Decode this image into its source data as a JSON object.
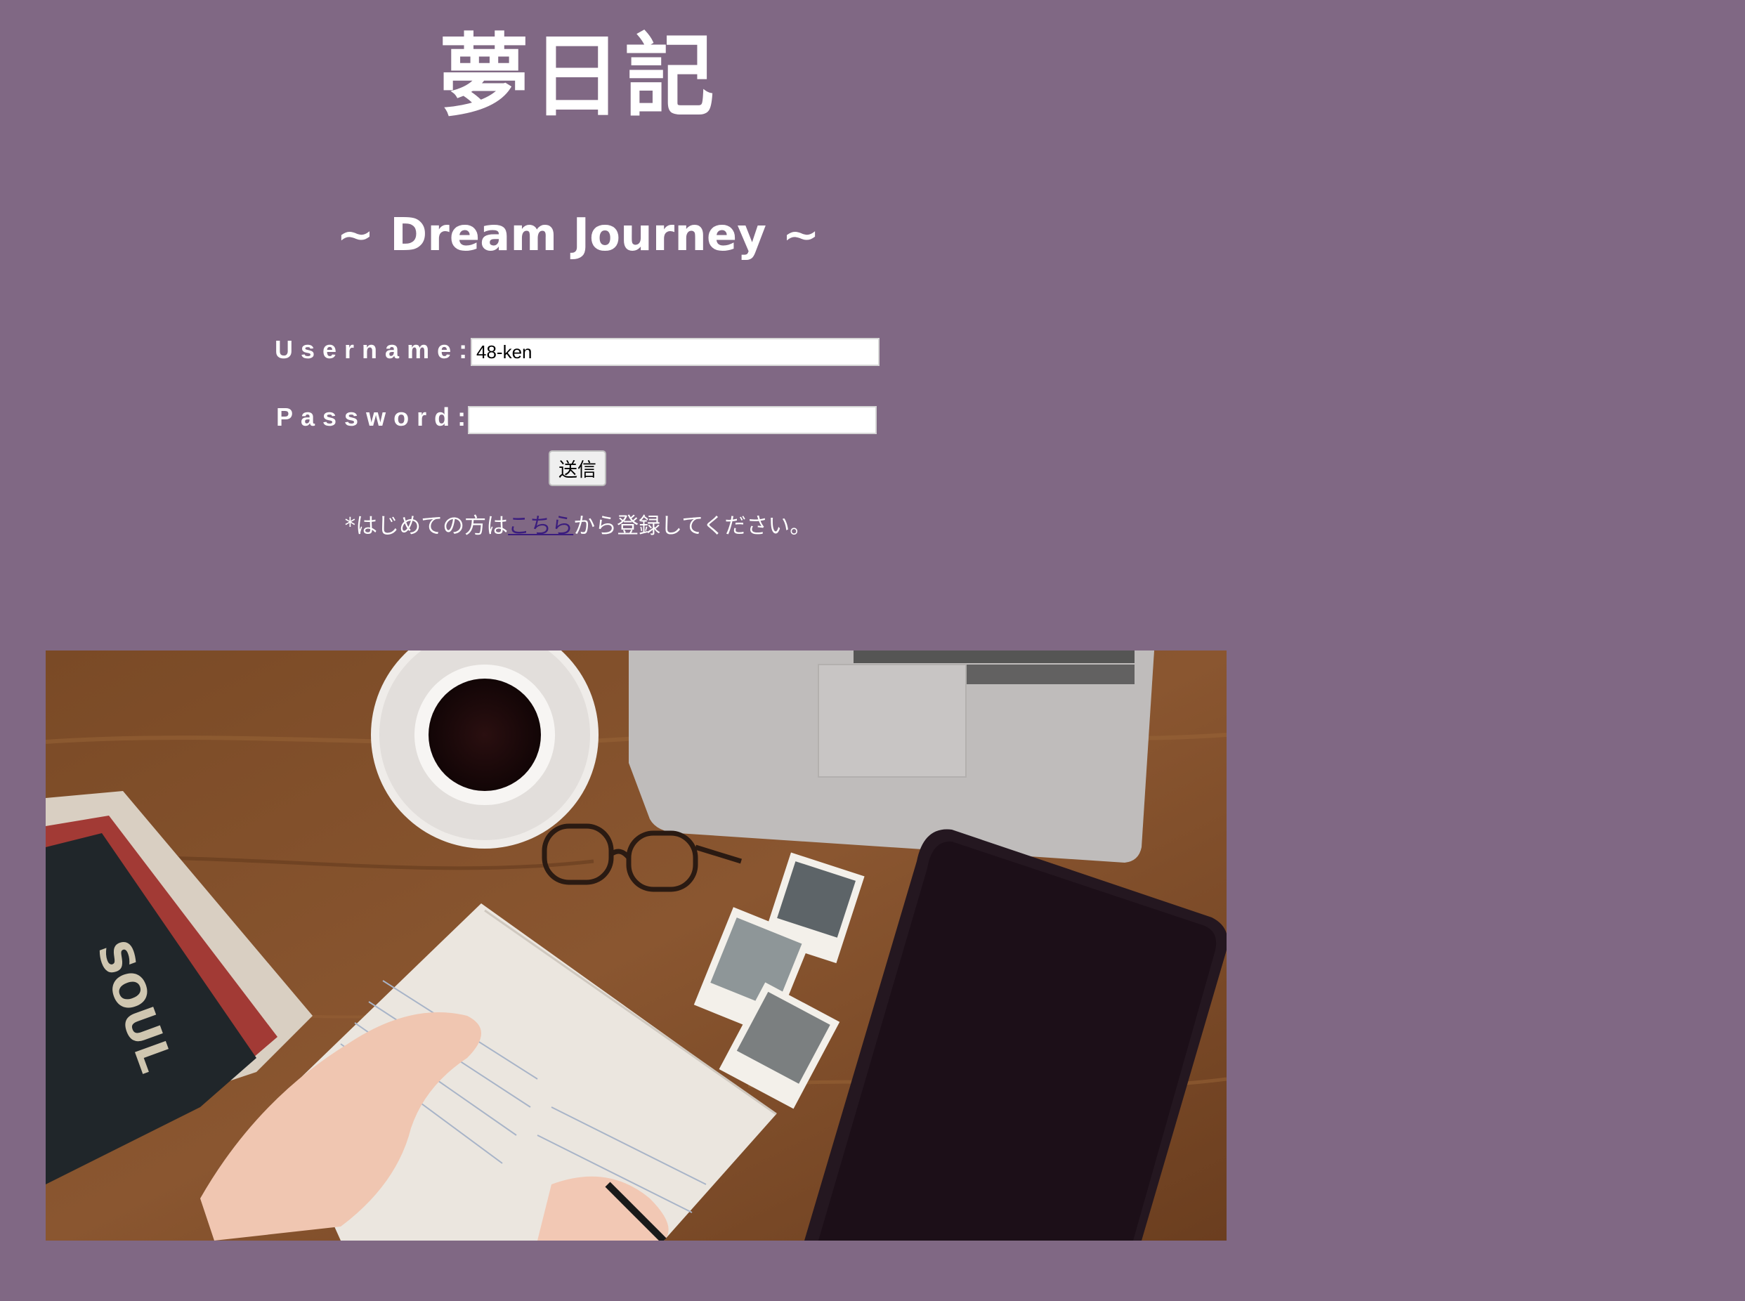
{
  "colors": {
    "background": "#806884",
    "heading_text": "#ffffff",
    "link": "#3b1d7e",
    "button_bg": "#efefef",
    "input_bg": "#ffffff"
  },
  "header": {
    "title": "夢日記",
    "subtitle": "~ Dream Journey ~"
  },
  "login_form": {
    "username_label": "Username:",
    "username_value": "48-ken",
    "password_label": "Password:",
    "password_value": "",
    "submit_label": "送信"
  },
  "register_note": {
    "prefix": "*はじめての方は",
    "link_text": "こちら",
    "suffix": "から登録してください。"
  },
  "hero_image": {
    "book_cover_text": "SOUL"
  }
}
